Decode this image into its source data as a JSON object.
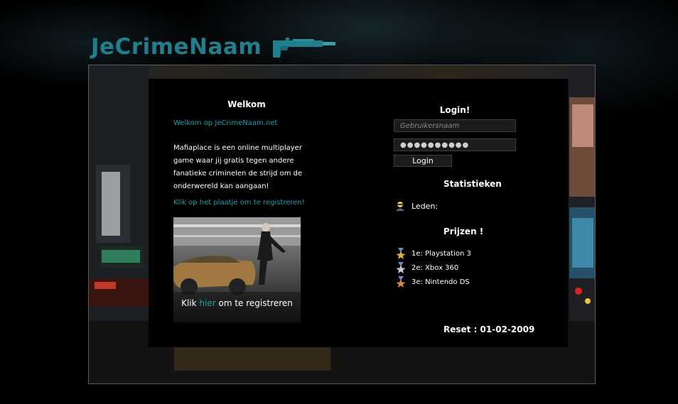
{
  "header": {
    "logo_text": "JeCrimeNaam"
  },
  "welcome": {
    "title": "Welkom",
    "greeting": "Welkom op JeCrimeNaam.net",
    "intro": "Mafiaplace is een online multiplayer game waar jij gratis tegen andere fanatieke criminelen de strijd om de onderwereld kan aangaan!",
    "register_hint": "Klik op het plaatje om te registreren!",
    "promo_caption_before": "Klik ",
    "promo_caption_link": "hier",
    "promo_caption_after": " om te registreren"
  },
  "login": {
    "title": "Login!",
    "username_placeholder": "Gebruikersnaam",
    "password_value": "●●●●●●●●●●",
    "button_label": "Login"
  },
  "stats": {
    "title": "Statistieken",
    "members_label": "Leden:",
    "members_icon": "user-icon"
  },
  "prizes": {
    "title": "Prijzen !",
    "items": [
      {
        "label": "1e: Playstation 3",
        "icon": "medal-gold-icon",
        "color": "#e0b23a"
      },
      {
        "label": "2e: Xbox 360",
        "icon": "medal-silver-icon",
        "color": "#c8ccd2"
      },
      {
        "label": "3e: Nintendo DS",
        "icon": "medal-bronze-icon",
        "color": "#d88a3a"
      }
    ]
  },
  "reset": {
    "text": "Reset : 01-02-2009"
  },
  "colors": {
    "accent": "#1aa0a8",
    "logo": "#1f7f8c"
  }
}
